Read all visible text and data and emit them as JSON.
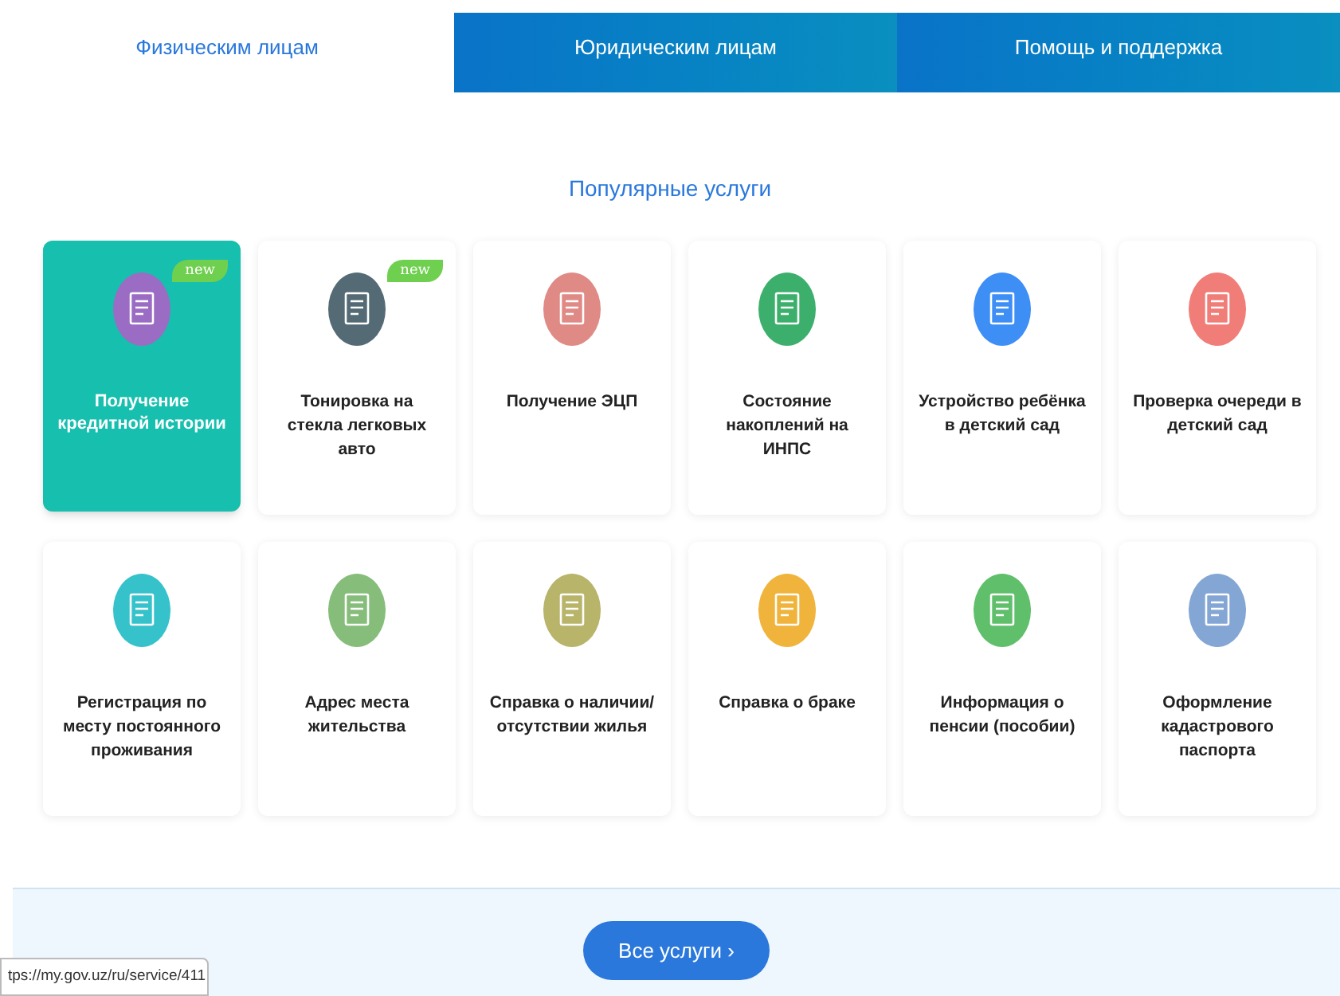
{
  "tabs": [
    {
      "label": "Физическим лицам",
      "selected": true
    },
    {
      "label": "Юридическим лицам",
      "selected": false
    },
    {
      "label": "Помощь и поддержка",
      "selected": false
    }
  ],
  "section_title": "Популярные услуги",
  "services": [
    {
      "title": "Получение кредитной истории",
      "color": "#9b6cc4",
      "badge": "new",
      "selected": true
    },
    {
      "title": "Тонировка на стекла легковых авто",
      "color": "#546a74",
      "badge": "new",
      "selected": false
    },
    {
      "title": "Получение ЭЦП",
      "color": "#e08a86",
      "selected": false
    },
    {
      "title": "Состояние накоплений на ИНПС",
      "color": "#3daf6c",
      "selected": false
    },
    {
      "title": "Устройство ребёнка в детский сад",
      "color": "#3d8ef5",
      "selected": false
    },
    {
      "title": "Проверка очереди в детский сад",
      "color": "#f07d78",
      "selected": false
    },
    {
      "title": "Регистрация по месту постоянного проживания",
      "color": "#36c2cb",
      "selected": false
    },
    {
      "title": "Адрес места жительства",
      "color": "#86bd7a",
      "selected": false
    },
    {
      "title": "Справка о наличии/ отсутствии жилья",
      "color": "#b8b46a",
      "selected": false
    },
    {
      "title": "Справка о браке",
      "color": "#f0b43c",
      "selected": false
    },
    {
      "title": "Информация о пенсии (пособии)",
      "color": "#5fbf6a",
      "selected": false
    },
    {
      "title": "Оформление кадастрового паспорта",
      "color": "#84a6d4",
      "selected": false
    }
  ],
  "all_services_button": "Все услуги ›",
  "status_url": "tps://my.gov.uz/ru/service/411"
}
